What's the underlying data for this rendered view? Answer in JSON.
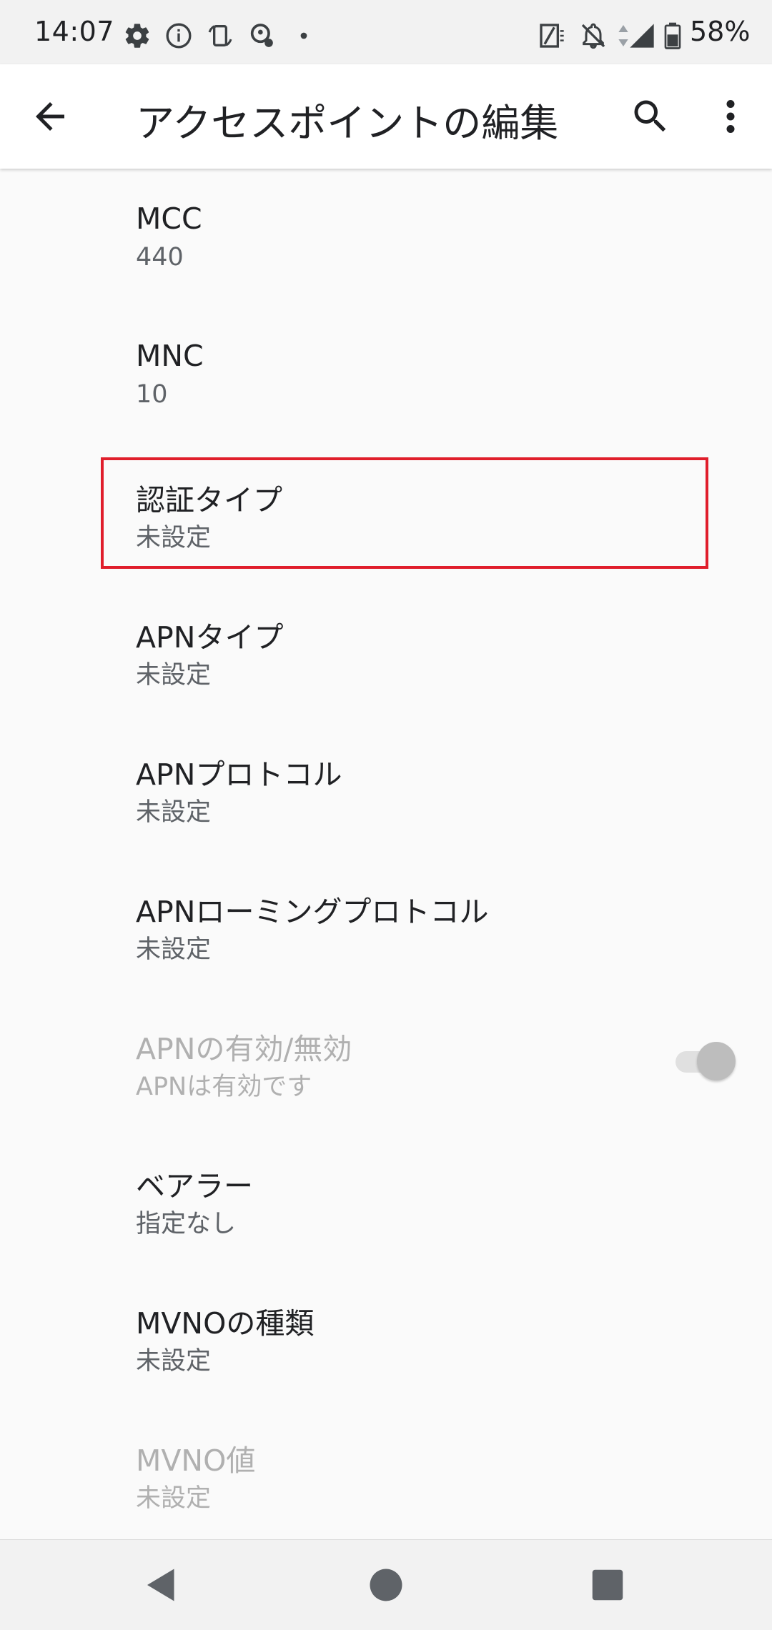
{
  "status_bar": {
    "time": "14:07",
    "battery_percent": "58%",
    "icons_left": [
      "settings-icon",
      "info-icon",
      "rotation-icon",
      "accessibility-icon",
      "dot-icon"
    ],
    "icons_right": [
      "nfc-icon",
      "notifications-off-icon",
      "signal-icon",
      "battery-icon"
    ]
  },
  "app_bar": {
    "title": "アクセスポイントの編集",
    "back_icon": "arrow-back-icon",
    "search_icon": "search-icon",
    "more_icon": "more-vert-icon"
  },
  "preferences": [
    {
      "title": "MCC",
      "summary": "440",
      "enabled": true
    },
    {
      "title": "MNC",
      "summary": "10",
      "enabled": true
    },
    {
      "title": "認証タイプ",
      "summary": "未設定",
      "enabled": true,
      "highlighted": true
    },
    {
      "title": "APNタイプ",
      "summary": "未設定",
      "enabled": true
    },
    {
      "title": "APNプロトコル",
      "summary": "未設定",
      "enabled": true
    },
    {
      "title": "APNローミングプロトコル",
      "summary": "未設定",
      "enabled": true
    },
    {
      "title": "APNの有効/無効",
      "summary": "APNは有効です",
      "enabled": false,
      "toggle_on": true
    },
    {
      "title": "ベアラー",
      "summary": "指定なし",
      "enabled": true
    },
    {
      "title": "MVNOの種類",
      "summary": "未設定",
      "enabled": true
    },
    {
      "title": "MVNO値",
      "summary": "未設定",
      "enabled": false
    }
  ],
  "colors": {
    "highlight": "#e01e2b",
    "background": "#fafafa",
    "text_primary": "#202124",
    "text_secondary": "#5f6368",
    "text_disabled": "#b0b0b0"
  },
  "nav_bar": {
    "back": "nav-back-icon",
    "home": "nav-home-icon",
    "recents": "nav-recents-icon"
  }
}
